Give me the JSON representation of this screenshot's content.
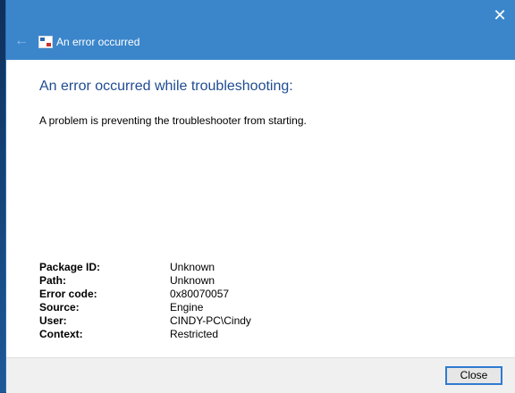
{
  "window": {
    "title": "An error occurred",
    "back_glyph": "←",
    "close_glyph": "✕"
  },
  "content": {
    "heading": "An error occurred while troubleshooting:",
    "message": "A problem is preventing the troubleshooter from starting."
  },
  "details": [
    {
      "label": "Package ID:",
      "value": "Unknown"
    },
    {
      "label": "Path:",
      "value": "Unknown"
    },
    {
      "label": "Error code:",
      "value": "0x80070057"
    },
    {
      "label": "Source:",
      "value": "Engine"
    },
    {
      "label": "User:",
      "value": "CINDY-PC\\Cindy"
    },
    {
      "label": "Context:",
      "value": "Restricted"
    }
  ],
  "footer": {
    "close_label": "Close"
  },
  "colors": {
    "titlebar": "#3b86cb",
    "heading": "#1f4c92",
    "button_focus": "#2f7bd1"
  }
}
